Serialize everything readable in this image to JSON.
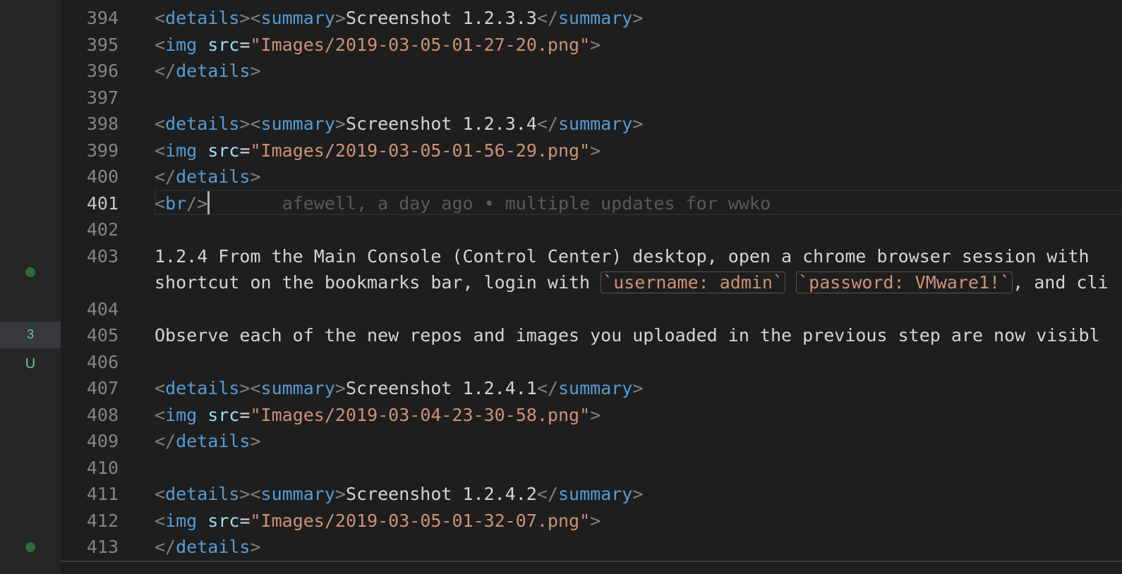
{
  "gutter": {
    "change_count": "3",
    "untracked_marker": "U"
  },
  "lines": {
    "l394": {
      "num": "394",
      "tag1": "details",
      "tag2": "summary",
      "text": "Screenshot 1.2.3.3"
    },
    "l395": {
      "num": "395",
      "attr": "src",
      "value": "\"Images/2019-03-05-01-27-20.png\""
    },
    "l396": {
      "num": "396"
    },
    "l397": {
      "num": "397"
    },
    "l398": {
      "num": "398",
      "text": "Screenshot 1.2.3.4"
    },
    "l399": {
      "num": "399",
      "value": "\"Images/2019-03-05-01-56-29.png\""
    },
    "l400": {
      "num": "400"
    },
    "l401": {
      "num": "401",
      "tag": "br",
      "blame": "afewell, a day ago • multiple updates for wwko"
    },
    "l402": {
      "num": "402"
    },
    "l403": {
      "num": "403",
      "text_a": "1.2.4 From the Main Console (Control Center) desktop, open a chrome browser session with ",
      "text_b": "shortcut on the bookmarks bar, login with ",
      "code1": "`username: admin`",
      "code2": "`password: VMware1!`",
      "text_c": ", and cli"
    },
    "l404": {
      "num": "404"
    },
    "l405": {
      "num": "405",
      "text": "Observe each of the new repos and images you uploaded in the previous step are now visibl"
    },
    "l406": {
      "num": "406"
    },
    "l407": {
      "num": "407",
      "text": "Screenshot 1.2.4.1"
    },
    "l408": {
      "num": "408",
      "value": "\"Images/2019-03-04-23-30-58.png\""
    },
    "l409": {
      "num": "409"
    },
    "l410": {
      "num": "410"
    },
    "l411": {
      "num": "411",
      "text": "Screenshot 1.2.4.2"
    },
    "l412": {
      "num": "412",
      "value": "\"Images/2019-03-05-01-32-07.png\""
    },
    "l413": {
      "num": "413"
    }
  },
  "tokens": {
    "details": "details",
    "summary": "summary",
    "img": "img",
    "src": "src"
  },
  "colors": {
    "tag": "#569cd6",
    "attr": "#9cdcfe",
    "string": "#ce9178",
    "punct": "#808080",
    "line_number": "#858585",
    "background": "#1e1e1e",
    "git_added": "#73c991"
  }
}
